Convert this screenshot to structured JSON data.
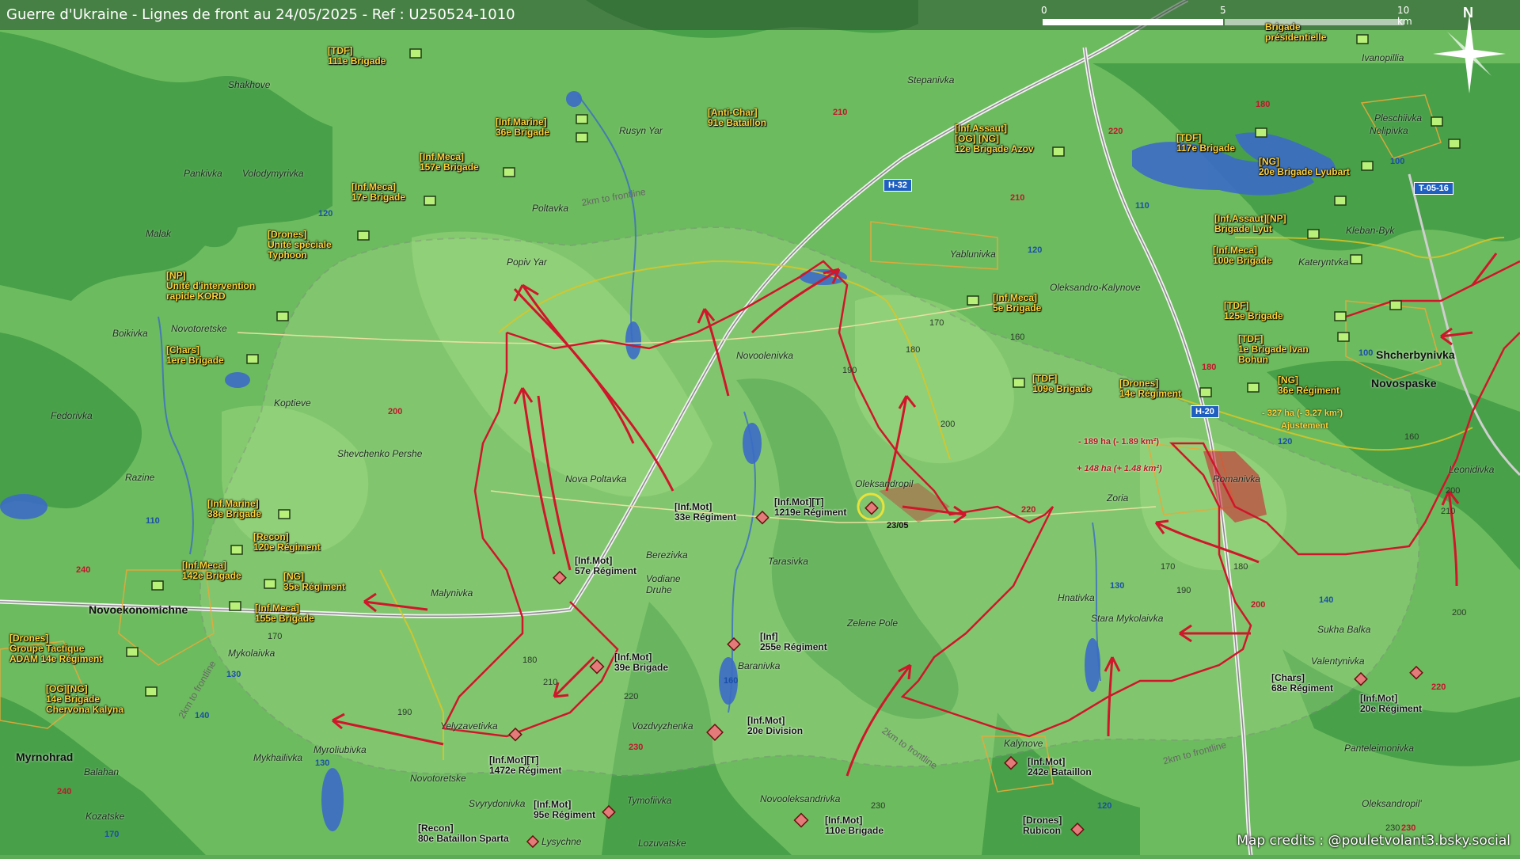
{
  "title": "Guerre d'Ukraine - Lignes de front au 24/05/2025 - Ref : U250524-1010",
  "scale": {
    "ticks": [
      "0",
      "5",
      "10 km"
    ]
  },
  "north": "N",
  "credits": "Map credits : @pouletvolant3.bsky.social",
  "colors": {
    "ua_label": "#ffd23b",
    "front_line": "#d0162a",
    "attack_arrow": "#d0162a",
    "road_badge": "#1f5fbf"
  },
  "towns": [
    {
      "name": "Novoekonomichne"
    },
    {
      "name": "Myrnohrad"
    },
    {
      "name": "Shcherbynivka"
    },
    {
      "name": "Novospaske"
    }
  ],
  "villages": [
    "Shakhove",
    "Pankivka",
    "Volodymyrivka",
    "Malak",
    "Novotoretske",
    "Boikivka",
    "Koptieve",
    "Fedorivka",
    "Razine",
    "Shevchenko Pershe",
    "Nova Poltavka",
    "Popiv Yar",
    "Poltavka",
    "Rusyn Yar",
    "Stepanivka",
    "Yablunivka",
    "Oleksandro-Kalynove",
    "Novoolenivka",
    "Oleksandropil",
    "Berezivka",
    "Vodiane Druhe",
    "Tarasivka",
    "Zelene Pole",
    "Baranivka",
    "Vozdvyzhenka",
    "Malynivka",
    "Yelyzavetivka",
    "Myroliubivka",
    "Mykhailivka",
    "Balahan",
    "Kozatske",
    "Novotoretske",
    "Svyrydonivka",
    "Tymofiivka",
    "Lysychne",
    "Lozuvatske",
    "Novooleksandrivka",
    "Kalynove",
    "Hnativka",
    "Stara Mykolaivka",
    "Zoria",
    "Romanivka",
    "Leonidivka",
    "Sukha Balka",
    "Valentynivka",
    "Panteleimonivka",
    "Oleksandropil'",
    "Kateryntvka",
    "Kleban-Byk",
    "Pleschiivka",
    "Nelipivka",
    "Ivanopillia",
    "Mykolaivka"
  ],
  "ua_units": [
    "[TDF]\n111e Brigade",
    "[Anti-Char]\n91e Bataillon",
    "[Inf.Marine]\n36e Brigade",
    "[Inf.Meca]\n157e Brigade",
    "[Inf.Meca]\n17e Brigade",
    "[Drones]\nUnité spéciale\nTyphoon",
    "[NP]\nUnité d'intervention\nrapide KORD",
    "[Chars]\n1ere Brigade",
    "[Inf.Marine]\n38e Brigade",
    "[Recon]\n120e Régiment",
    "[Inf.Meca]\n142e Brigade",
    "[NG]\n35e Régiment",
    "[Inf.Meca]\n155e Brigade",
    "[Drones]\nGroupe Tactique\nADAM 14e Régiment",
    "[OG][NG]\n14e Brigade\nChervona Kalyna",
    "[Inf.Assaut]\n[OG] [NG]\n12e Brigade Azov",
    "[Inf.Meca]\n5e Brigade",
    "[TDF]\n109e Brigade",
    "[Drones]\n14e Régiment",
    "[NG]\n36e Régiment",
    "[TDF]\n117e Brigade",
    "[NG]\n20e Brigade Lyubart",
    "[Inf.Assaut][NP]\nBrigade Lyut",
    "[Inf.Meca]\n100e Brigade",
    "[TDF]\n125e Brigade",
    "[TDF]\n1e Brigade Ivan\nBohun",
    "Brigade\nprésidentielle"
  ],
  "ru_units": [
    "[Inf.Mot]\n57e Régiment",
    "[Inf.Mot]\n33e Régiment",
    "[Inf.Mot][T]\n1219e Régiment",
    "[Inf.Mot]\n39e Brigade",
    "[Inf]\n255e Régiment",
    "[Inf.Mot]\n20e Division",
    "[Inf.Mot][T]\n1472e Régiment",
    "[Inf.Mot]\n95e Régiment",
    "[Recon]\n80e Bataillon Sparta",
    "[Inf.Mot]\n110e Brigade",
    "[Inf.Mot]\n242e Bataillon",
    "[Drones]\nRubicon",
    "[Chars]\n68e Régiment",
    "[Inf.Mot]\n20e Régiment"
  ],
  "roads": [
    "H-32",
    "H-20",
    "T-05-16"
  ],
  "road_numbers_red": [
    "210",
    "220",
    "180",
    "210",
    "220",
    "200",
    "240",
    "240",
    "230",
    "230",
    "200",
    "220",
    "180"
  ],
  "road_numbers_blue": [
    "120",
    "110",
    "120",
    "130",
    "140",
    "160",
    "130",
    "170",
    "100",
    "110",
    "120",
    "130",
    "140",
    "120",
    "100"
  ],
  "altitudes": [
    "170",
    "180",
    "190",
    "160",
    "200",
    "190",
    "170",
    "180",
    "210",
    "220",
    "190",
    "200",
    "160",
    "170",
    "200",
    "180",
    "210",
    "230",
    "230"
  ],
  "annotations": {
    "loss1": "- 189 ha (- 1.89 km²)",
    "gain": "+ 148 ha (+ 1.48 km²)",
    "loss2": "- 327 ha (- 3.27 km²)",
    "adjust": "Ajustement",
    "date": "23/05"
  },
  "frontline_label": "2km to frontline"
}
